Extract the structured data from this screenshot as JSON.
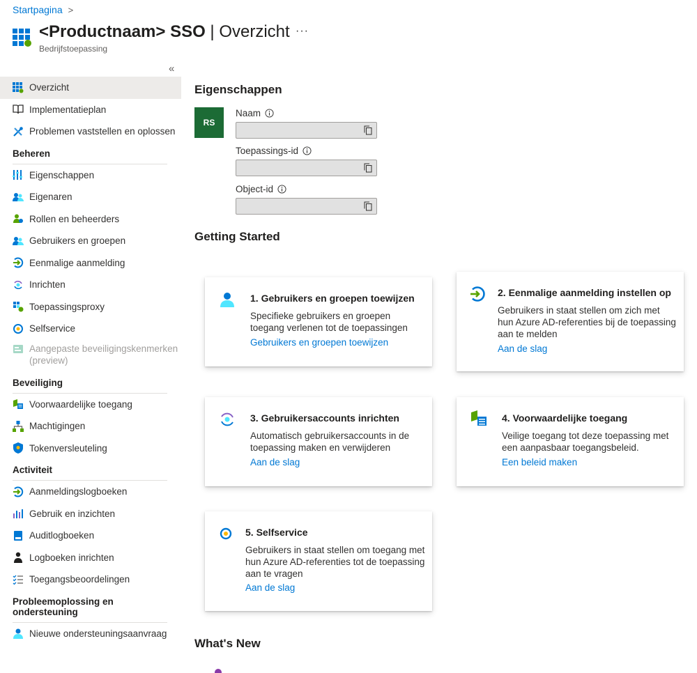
{
  "breadcrumb": {
    "home": "Startpagina",
    "separator": ">"
  },
  "header": {
    "title_bold": "<Productnaam> SSO",
    "title_rest": " | Overzicht",
    "more": "···",
    "subtitle": "Bedrijfstoepassing",
    "collapse": "«"
  },
  "sidebar": {
    "top": [
      {
        "label": "Overzicht"
      },
      {
        "label": "Implementatieplan"
      },
      {
        "label": "Problemen vaststellen en oplossen"
      }
    ],
    "manage": {
      "title": "Beheren",
      "items": [
        {
          "label": "Eigenschappen"
        },
        {
          "label": "Eigenaren"
        },
        {
          "label": "Rollen en beheerders"
        },
        {
          "label": "Gebruikers en groepen"
        },
        {
          "label": "Eenmalige aanmelding"
        },
        {
          "label": "Inrichten"
        },
        {
          "label": "Toepassingsproxy"
        },
        {
          "label": "Selfservice"
        },
        {
          "label": "Aangepaste beveiligingskenmerken (preview)"
        }
      ]
    },
    "security": {
      "title": "Beveiliging",
      "items": [
        {
          "label": "Voorwaardelijke toegang"
        },
        {
          "label": "Machtigingen"
        },
        {
          "label": "Tokenversleuteling"
        }
      ]
    },
    "activity": {
      "title": "Activiteit",
      "items": [
        {
          "label": "Aanmeldingslogboeken"
        },
        {
          "label": "Gebruik en inzichten"
        },
        {
          "label": "Auditlogboeken"
        },
        {
          "label": "Logboeken inrichten"
        },
        {
          "label": "Toegangsbeoordelingen"
        }
      ]
    },
    "support": {
      "title": "Probleemoplossing en ondersteuning",
      "items": [
        {
          "label": "Nieuwe ondersteuningsaanvraag"
        }
      ]
    }
  },
  "properties": {
    "title": "Eigenschappen",
    "avatar": "RS",
    "fields": [
      {
        "label": "Naam",
        "value": ""
      },
      {
        "label": "Toepassings-id",
        "value": ""
      },
      {
        "label": "Object-id",
        "value": ""
      }
    ]
  },
  "getting_started": {
    "title": "Getting Started",
    "cards": [
      {
        "title": "1. Gebruikers en groepen toewijzen",
        "desc": "Specifieke gebruikers en groepen toegang verlenen tot de toepassingen",
        "link": "Gebruikers en groepen toewijzen"
      },
      {
        "title": "2. Eenmalige aanmelding instellen op",
        "desc": "Gebruikers in staat stellen om zich met hun Azure AD-referenties bij de toepassing aan te melden",
        "link": "Aan de slag"
      },
      {
        "title": "3. Gebruikersaccounts inrichten",
        "desc": "Automatisch gebruikersaccounts in de toepassing maken en verwijderen",
        "link": "Aan de slag"
      },
      {
        "title": "4. Voorwaardelijke toegang",
        "desc": "Veilige toegang tot deze toepassing met een aanpasbaar toegangsbeleid.",
        "link": "Een beleid maken"
      },
      {
        "title": "5. Selfservice",
        "desc": "Gebruikers in staat stellen om toegang met hun Azure AD-referenties tot de toepassing aan te vragen",
        "link": "Aan de slag"
      }
    ]
  },
  "whats_new": {
    "title": "What's New"
  }
}
